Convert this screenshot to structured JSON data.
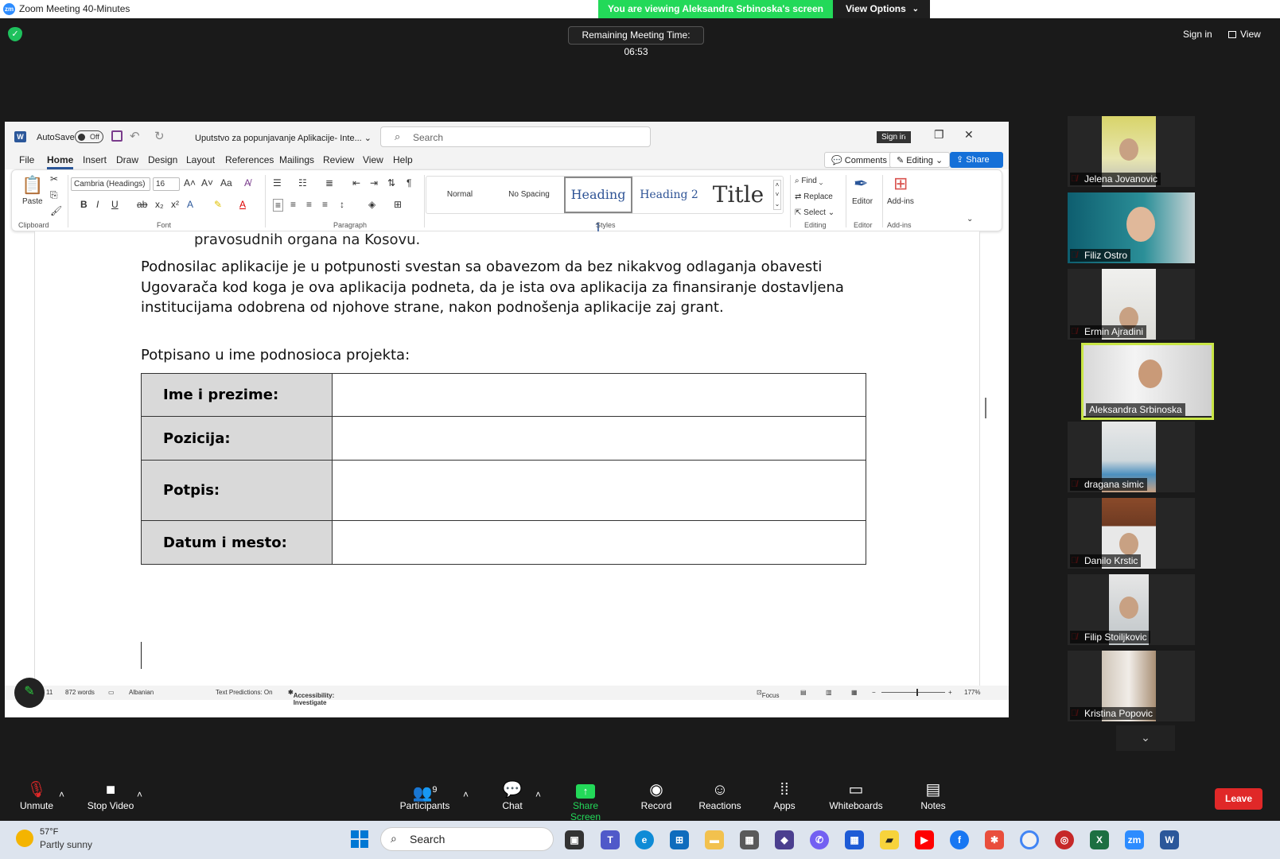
{
  "zoom": {
    "window_title": "Zoom Meeting 40-Minutes",
    "logo_text": "zm",
    "viewing_banner": "You are viewing Aleksandra Srbinoska's screen",
    "view_options": "View Options",
    "remaining_time": "Remaining Meeting Time: 06:53",
    "sign_in": "Sign in",
    "view": "View"
  },
  "word": {
    "autosave_label": "AutoSave",
    "autosave_state": "Off",
    "doc_name": "Uputstvo za popunjavanje Aplikacije- Inte...",
    "search_placeholder": "Search",
    "sign_in": "Sign in",
    "menu": [
      "File",
      "Home",
      "Insert",
      "Draw",
      "Design",
      "Layout",
      "References",
      "Mailings",
      "Review",
      "View",
      "Help"
    ],
    "comments": "Comments",
    "editing": "Editing",
    "share": "Share",
    "ribbon": {
      "paste": "Paste",
      "font_name": "Cambria (Headings)",
      "font_size": "16",
      "styles": [
        "Normal",
        "No Spacing",
        "Heading 1",
        "Heading 2",
        "Title"
      ],
      "find": "Find",
      "replace": "Replace",
      "select": "Select",
      "editor": "Editor",
      "addins": "Add-ins",
      "groups": [
        "Clipboard",
        "Font",
        "Paragraph",
        "Styles",
        "Editing",
        "Editor",
        "Add-ins"
      ]
    },
    "document": {
      "cut_line": "pravosudnih organa na Kosovu.",
      "paragraph": "Podnosilac aplikacije je u potpunosti  svestan sa obavezom da bez nikakvog odlaganja obavesti Ugovarača kod koga je ova aplikacija  podneta, da je ista ova aplikacija  za finansiranje  dostavljena institucijama odobrena od njohove strane, nakon podnošenja aplikacije zaj grant.",
      "signed_heading": "Potpisano u ime podnosioca projekta:",
      "table_rows": [
        "Ime i prezime:",
        "Pozicija:",
        "Potpis:",
        "Datum i mesto:"
      ]
    },
    "status": {
      "page": "11",
      "words": "872 words",
      "language": "Albanian",
      "text_predictions": "Text Predictions: On",
      "accessibility": "Accessibility: Investigate",
      "focus": "Focus",
      "zoom": "177%"
    }
  },
  "participants": [
    {
      "name": "Jelena Jovanovic",
      "muted": true
    },
    {
      "name": "Filiz Ostro",
      "muted": true
    },
    {
      "name": "Ermin Ajradini",
      "muted": true
    },
    {
      "name": "Aleksandra Srbinoska",
      "muted": false,
      "active_speaker": true
    },
    {
      "name": "dragana simic",
      "muted": true
    },
    {
      "name": "Danilo Krstic",
      "muted": true
    },
    {
      "name": "Filip Stoiljkovic",
      "muted": true
    },
    {
      "name": "Kristina Popovic",
      "muted": true
    }
  ],
  "toolbar": {
    "unmute": "Unmute",
    "stop_video": "Stop Video",
    "participants": "Participants",
    "participants_count": "9",
    "chat": "Chat",
    "share_screen": "Share Screen",
    "record": "Record",
    "reactions": "Reactions",
    "apps": "Apps",
    "whiteboards": "Whiteboards",
    "notes": "Notes",
    "leave": "Leave"
  },
  "taskbar": {
    "temperature": "57°F",
    "weather": "Partly sunny",
    "search": "Search"
  },
  "colors": {
    "banner_green": "#23d959",
    "share_green": "#23d959",
    "leave_red": "#e02828",
    "word_blue": "#2b579a",
    "active_speaker": "#c9e646"
  }
}
